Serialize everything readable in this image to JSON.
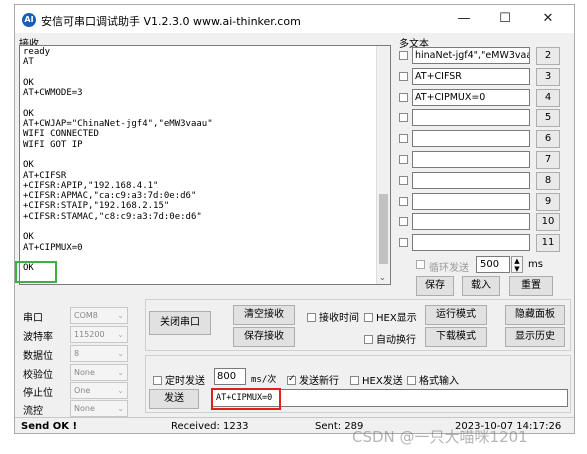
{
  "window": {
    "title": "安信可串口调试助手 V1.2.3.0    www.ai-thinker.com",
    "icon_text": "AI",
    "minimize": "—",
    "maximize": "☐",
    "close": "✕"
  },
  "receive": {
    "label": "接收",
    "lines": [
      "ready",
      "AT",
      "",
      "OK",
      "AT+CWMODE=3",
      "",
      "OK",
      "AT+CWJAP=\"ChinaNet-jgf4\",\"eMW3vaau\"",
      "WIFI CONNECTED",
      "WIFI GOT IP",
      "",
      "OK",
      "AT+CIFSR",
      "+CIFSR:APIP,\"192.168.4.1\"",
      "+CIFSR:APMAC,\"ca:c9:a3:7d:0e:d6\"",
      "+CIFSR:STAIP,\"192.168.2.15\"",
      "+CIFSR:STAMAC,\"c8:c9:a3:7d:0e:d6\"",
      "",
      "OK",
      "AT+CIPMUX=0",
      "",
      "OK"
    ]
  },
  "multi": {
    "label": "多文本",
    "rows": [
      {
        "text": "hinaNet-jgf4\",\"eMW3vaau\"",
        "num": "2"
      },
      {
        "text": "AT+CIFSR",
        "num": "3"
      },
      {
        "text": "AT+CIPMUX=0",
        "num": "4"
      },
      {
        "text": "",
        "num": "5"
      },
      {
        "text": "",
        "num": "6"
      },
      {
        "text": "",
        "num": "7"
      },
      {
        "text": "",
        "num": "8"
      },
      {
        "text": "",
        "num": "9"
      },
      {
        "text": "",
        "num": "10"
      },
      {
        "text": "",
        "num": "11"
      }
    ],
    "loop_label": "循环发送",
    "loop_value": "500",
    "loop_unit": "ms",
    "save": "保存",
    "load": "载入",
    "reset": "重置"
  },
  "settings": {
    "port_label": "串口",
    "port_value": "COM8",
    "baud_label": "波特率",
    "baud_value": "115200",
    "databits_label": "数据位",
    "databits_value": "8",
    "parity_label": "校验位",
    "parity_value": "None",
    "stopbits_label": "停止位",
    "stopbits_value": "One",
    "flow_label": "流控",
    "flow_value": "None"
  },
  "controls": {
    "close_port": "关闭串口",
    "clear_recv": "清空接收",
    "save_recv": "保存接收",
    "recv_time": "接收时间",
    "hex_display": "HEX显示",
    "run_mode": "运行模式",
    "hide_panel": "隐藏面板",
    "auto_wrap": "自动换行",
    "download_mode": "下载模式",
    "show_history": "显示历史",
    "timed_send": "定时发送",
    "timed_value": "800",
    "timed_unit": "ms/次",
    "send_newline": "发送新行",
    "hex_send": "HEX发送",
    "format_input": "格式输入",
    "send": "发送",
    "send_text": "AT+CIPMUX=0"
  },
  "status": {
    "send_ok": "Send OK !",
    "received": "Received: 1233",
    "sent": "Sent: 289",
    "time": "2023-10-07 14:17:26"
  },
  "watermark": "CSDN @一只大喵咪1201"
}
